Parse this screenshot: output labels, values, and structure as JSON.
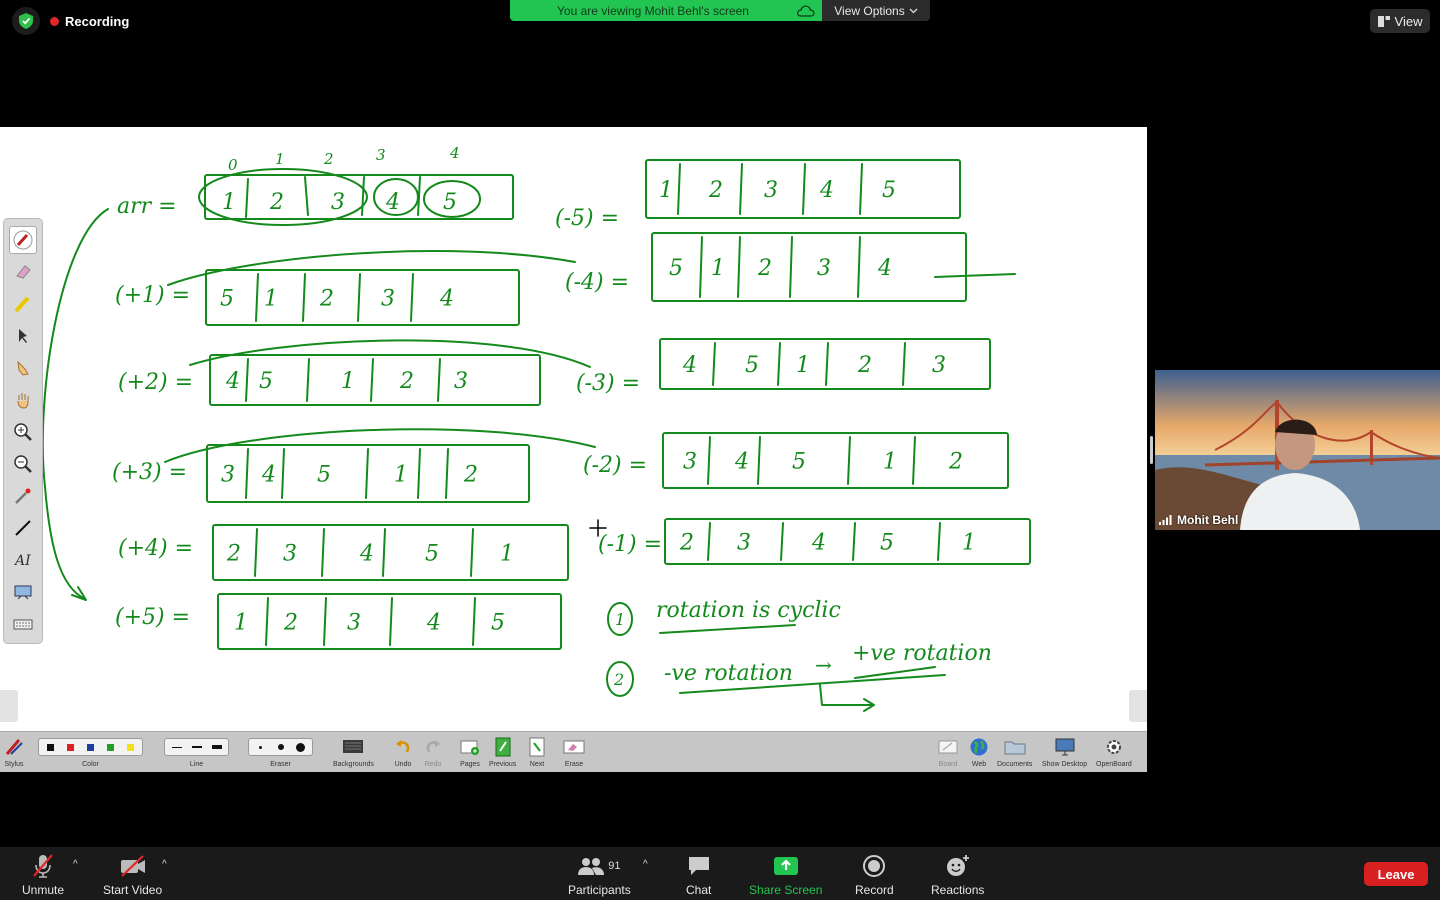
{
  "top_bar": {
    "recording_label": "Recording",
    "banner_text": "You are viewing Mohit Behl's screen",
    "view_options_label": "View Options",
    "view_label": "View"
  },
  "whiteboard": {
    "index_labels": [
      "0",
      "1",
      "2",
      "3",
      "4"
    ],
    "arr_label": "arr =",
    "rows_left": [
      {
        "label": "(+1) =",
        "values": [
          "5",
          "1",
          "2",
          "3",
          "4"
        ]
      },
      {
        "label": "(+2) =",
        "values": [
          "4",
          "5",
          "1",
          "2",
          "3"
        ]
      },
      {
        "label": "(+3) =",
        "values": [
          "3",
          "4",
          "5",
          "1",
          "2"
        ]
      },
      {
        "label": "(+4) =",
        "values": [
          "2",
          "3",
          "4",
          "5",
          "1"
        ]
      },
      {
        "label": "(+5) =",
        "values": [
          "1",
          "2",
          "3",
          "4",
          "5"
        ]
      }
    ],
    "arr_values": [
      "1",
      "2",
      "3",
      "4",
      "5"
    ],
    "rows_right": [
      {
        "label": "(-5) =",
        "values": [
          "1",
          "2",
          "3",
          "4",
          "5"
        ]
      },
      {
        "label": "(-4) =",
        "values": [
          "5",
          "1",
          "2",
          "3",
          "4"
        ]
      },
      {
        "label": "(-3) =",
        "values": [
          "4",
          "5",
          "1",
          "2",
          "3"
        ]
      },
      {
        "label": "(-2) =",
        "values": [
          "3",
          "4",
          "5",
          "1",
          "2"
        ]
      },
      {
        "label": "(-1) =",
        "values": [
          "2",
          "3",
          "4",
          "5",
          "1"
        ]
      }
    ],
    "note_1_num": "1",
    "note_1_text": "rotation is cyclic",
    "note_2_num": "2",
    "note_2_text_a": "-ve rotation",
    "note_2_arrow": "→",
    "note_2_text_b": "+ve rotation",
    "ink_color": "#138a1b"
  },
  "ob_toolbar": {
    "stylus": "Stylus",
    "color": "Color",
    "line": "Line",
    "eraser": "Eraser",
    "backgrounds": "Backgrounds",
    "undo": "Undo",
    "redo": "Redo",
    "pages": "Pages",
    "previous": "Previous",
    "next": "Next",
    "erase": "Erase",
    "board": "Board",
    "web": "Web",
    "documents": "Documents",
    "show_desktop": "Show Desktop",
    "openboard": "OpenBoard",
    "colors": [
      "#111111",
      "#e02020",
      "#1f3f9f",
      "#23a022",
      "#f2e21c"
    ]
  },
  "video": {
    "speaker_name": "Mohit Behl"
  },
  "controls": {
    "unmute": "Unmute",
    "start_video": "Start Video",
    "participants": "Participants",
    "participant_count": "91",
    "chat": "Chat",
    "share_screen": "Share Screen",
    "record": "Record",
    "reactions": "Reactions",
    "leave": "Leave",
    "share_color": "#23c552"
  }
}
